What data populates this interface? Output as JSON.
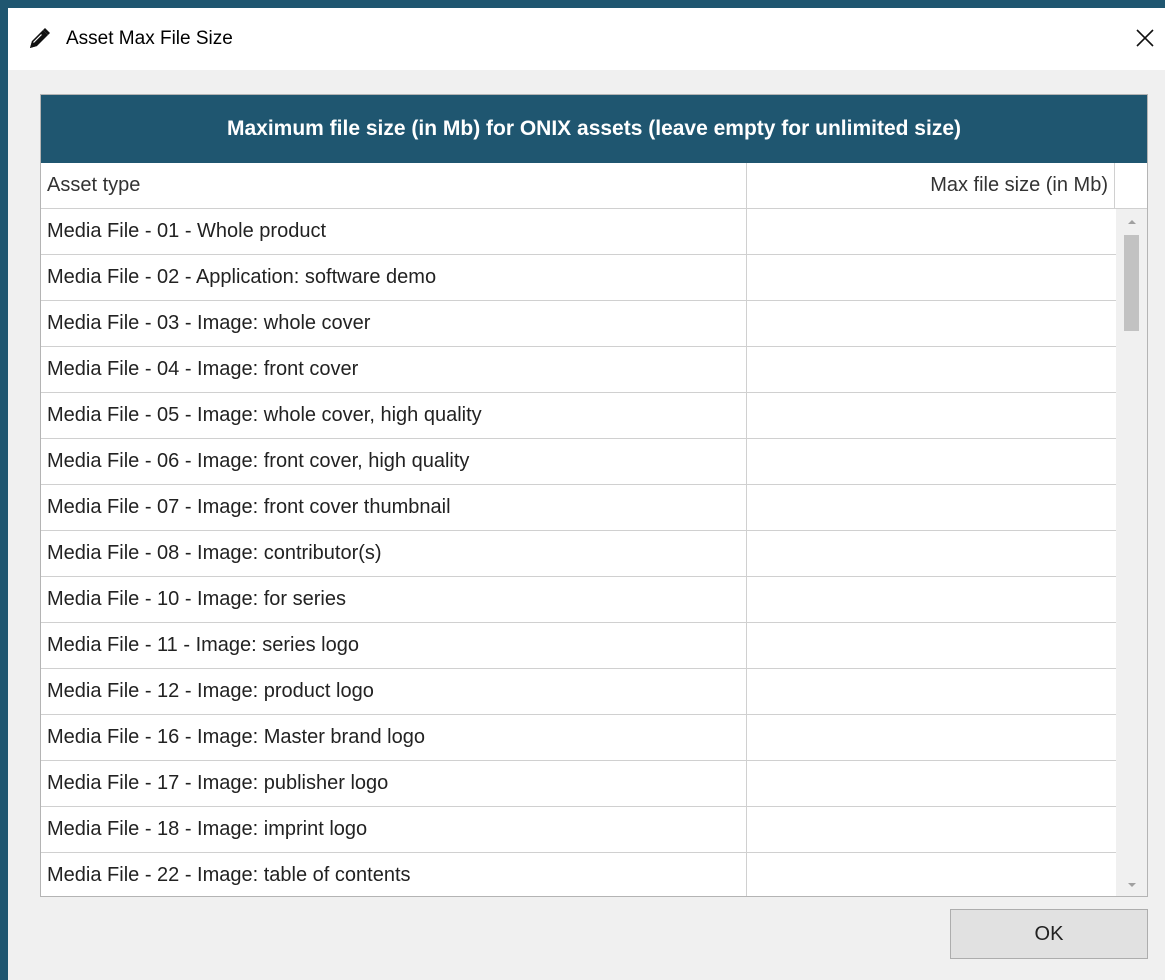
{
  "window": {
    "title": "Asset Max File Size"
  },
  "table": {
    "caption": "Maximum file size (in Mb) for ONIX assets (leave empty for unlimited size)",
    "columns": {
      "asset_type": "Asset type",
      "max_size": "Max file size (in Mb)"
    },
    "rows": [
      {
        "asset": "Media File - 01 - Whole product",
        "size": ""
      },
      {
        "asset": "Media File - 02 - Application: software demo",
        "size": ""
      },
      {
        "asset": "Media File - 03 - Image: whole cover",
        "size": ""
      },
      {
        "asset": "Media File - 04 - Image: front cover",
        "size": ""
      },
      {
        "asset": "Media File - 05 - Image: whole cover, high quality",
        "size": ""
      },
      {
        "asset": "Media File - 06 - Image: front cover, high quality",
        "size": ""
      },
      {
        "asset": "Media File - 07 - Image: front cover thumbnail",
        "size": ""
      },
      {
        "asset": "Media File - 08 - Image: contributor(s)",
        "size": ""
      },
      {
        "asset": "Media File - 10 - Image: for series",
        "size": ""
      },
      {
        "asset": "Media File - 11 - Image: series logo",
        "size": ""
      },
      {
        "asset": "Media File - 12 - Image: product logo",
        "size": ""
      },
      {
        "asset": "Media File - 16 - Image: Master brand logo",
        "size": ""
      },
      {
        "asset": "Media File - 17 - Image: publisher logo",
        "size": ""
      },
      {
        "asset": "Media File - 18 - Image: imprint logo",
        "size": ""
      },
      {
        "asset": "Media File - 22 - Image: table of contents",
        "size": ""
      }
    ]
  },
  "footer": {
    "ok_label": "OK"
  },
  "icons": {
    "title_icon": "pencil-icon",
    "close_icon": "close-icon",
    "scroll_up": "triangle-up-icon",
    "scroll_down": "triangle-down-icon"
  },
  "colors": {
    "header_bg": "#1f5670",
    "header_text": "#ffffff"
  }
}
